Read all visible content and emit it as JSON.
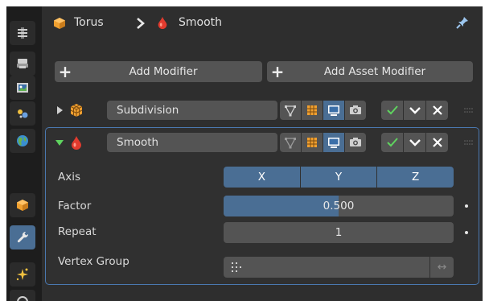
{
  "breadcrumb": {
    "object_name": "Torus",
    "modifier_name": "Smooth"
  },
  "buttons": {
    "add_modifier": "Add Modifier",
    "add_asset_modifier": "Add Asset Modifier"
  },
  "modifiers": [
    {
      "name": "Subdivision",
      "expanded": false,
      "editmode_on": false,
      "viewport_on": true,
      "render_on": false,
      "enabled": true
    },
    {
      "name": "Smooth",
      "expanded": true,
      "editmode_on": false,
      "viewport_on": true,
      "render_on": false,
      "enabled": true
    }
  ],
  "smooth_props": {
    "axis_label": "Axis",
    "axis_options": [
      "X",
      "Y",
      "Z"
    ],
    "factor_label": "Factor",
    "factor_value": "0.500",
    "factor_fraction": 0.5,
    "repeat_label": "Repeat",
    "repeat_value": "1",
    "vertex_group_label": "Vertex Group",
    "vertex_group_value": ""
  },
  "invert_symbol": "↔",
  "colors": {
    "accent": "#4a6e94",
    "focus_border": "#4a78b0",
    "check_green": "#5fd35f",
    "modifier_orange": "#f0a030",
    "smooth_red": "#e23b2e"
  },
  "icons": {
    "tabs": [
      "tool-icon",
      "render-icon",
      "output-icon",
      "view-layer-icon",
      "scene-icon",
      "world-icon",
      "object-icon",
      "modifier-icon",
      "particles-icon"
    ],
    "breadcrumb_object": "mesh-object-icon",
    "breadcrumb_sep": "chevron-right-icon",
    "breadcrumb_modifier": "smooth-modifier-icon",
    "pin": "pin-icon"
  }
}
